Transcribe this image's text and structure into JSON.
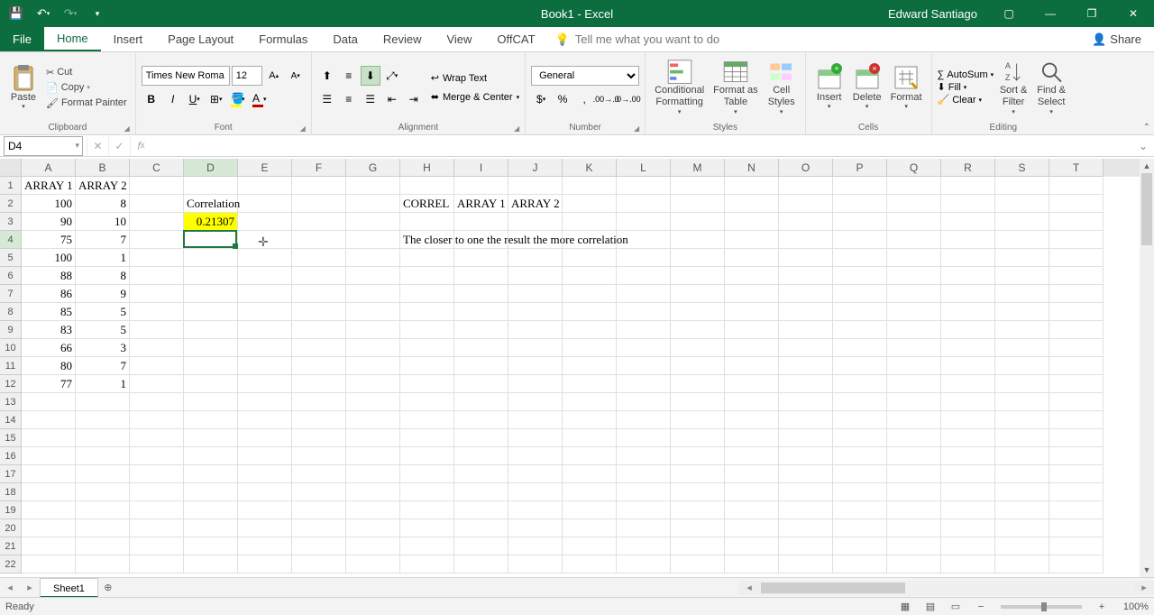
{
  "title": "Book1 - Excel",
  "user": "Edward Santiago",
  "tabs": {
    "file": "File",
    "home": "Home",
    "insert": "Insert",
    "page_layout": "Page Layout",
    "formulas": "Formulas",
    "data": "Data",
    "review": "Review",
    "view": "View",
    "offcat": "OffCAT",
    "tell_me": "Tell me what you want to do",
    "share": "Share"
  },
  "ribbon": {
    "clipboard": {
      "paste": "Paste",
      "cut": "Cut",
      "copy": "Copy",
      "format_painter": "Format Painter",
      "label": "Clipboard"
    },
    "font": {
      "name": "Times New Roma",
      "size": "12",
      "label": "Font"
    },
    "alignment": {
      "wrap": "Wrap Text",
      "merge": "Merge & Center",
      "label": "Alignment"
    },
    "number": {
      "format": "General",
      "label": "Number"
    },
    "styles": {
      "cond": "Conditional\nFormatting",
      "table": "Format as\nTable",
      "cell": "Cell\nStyles",
      "label": "Styles"
    },
    "cells": {
      "insert": "Insert",
      "delete": "Delete",
      "format": "Format",
      "label": "Cells"
    },
    "editing": {
      "autosum": "AutoSum",
      "fill": "Fill",
      "clear": "Clear",
      "sort": "Sort &\nFilter",
      "find": "Find &\nSelect",
      "label": "Editing"
    }
  },
  "formula_bar": {
    "name_box": "D4",
    "formula": ""
  },
  "columns": [
    "A",
    "B",
    "C",
    "D",
    "E",
    "F",
    "G",
    "H",
    "I",
    "J",
    "K",
    "L",
    "M",
    "N",
    "O",
    "P",
    "Q",
    "R",
    "S",
    "T"
  ],
  "rows": 22,
  "selected": {
    "col": 3,
    "row": 3
  },
  "cells": {
    "A1": {
      "v": "ARRAY 1",
      "t": "s"
    },
    "B1": {
      "v": "ARRAY 2",
      "t": "s"
    },
    "A2": {
      "v": "100",
      "t": "n"
    },
    "B2": {
      "v": "8",
      "t": "n"
    },
    "A3": {
      "v": "90",
      "t": "n"
    },
    "B3": {
      "v": "10",
      "t": "n"
    },
    "A4": {
      "v": "75",
      "t": "n"
    },
    "B4": {
      "v": "7",
      "t": "n"
    },
    "A5": {
      "v": "100",
      "t": "n"
    },
    "B5": {
      "v": "1",
      "t": "n"
    },
    "A6": {
      "v": "88",
      "t": "n"
    },
    "B6": {
      "v": "8",
      "t": "n"
    },
    "A7": {
      "v": "86",
      "t": "n"
    },
    "B7": {
      "v": "9",
      "t": "n"
    },
    "A8": {
      "v": "85",
      "t": "n"
    },
    "B8": {
      "v": "5",
      "t": "n"
    },
    "A9": {
      "v": "83",
      "t": "n"
    },
    "B9": {
      "v": "5",
      "t": "n"
    },
    "A10": {
      "v": "66",
      "t": "n"
    },
    "B10": {
      "v": "3",
      "t": "n"
    },
    "A11": {
      "v": "80",
      "t": "n"
    },
    "B11": {
      "v": "7",
      "t": "n"
    },
    "A12": {
      "v": "77",
      "t": "n"
    },
    "B12": {
      "v": "1",
      "t": "n"
    },
    "D2": {
      "v": "Correlation",
      "t": "s"
    },
    "D3": {
      "v": "0.21307",
      "t": "n",
      "hl": true
    },
    "H2": {
      "v": "CORREL",
      "t": "s"
    },
    "I2": {
      "v": "ARRAY 1",
      "t": "s"
    },
    "J2": {
      "v": "ARRAY 2",
      "t": "s"
    },
    "H4": {
      "v": "The closer to one the result the more correlation",
      "t": "s"
    }
  },
  "cursor_pos": {
    "col": 4,
    "row": 3
  },
  "sheet_tabs": {
    "active": "Sheet1"
  },
  "status": {
    "ready": "Ready",
    "zoom": "100%"
  }
}
